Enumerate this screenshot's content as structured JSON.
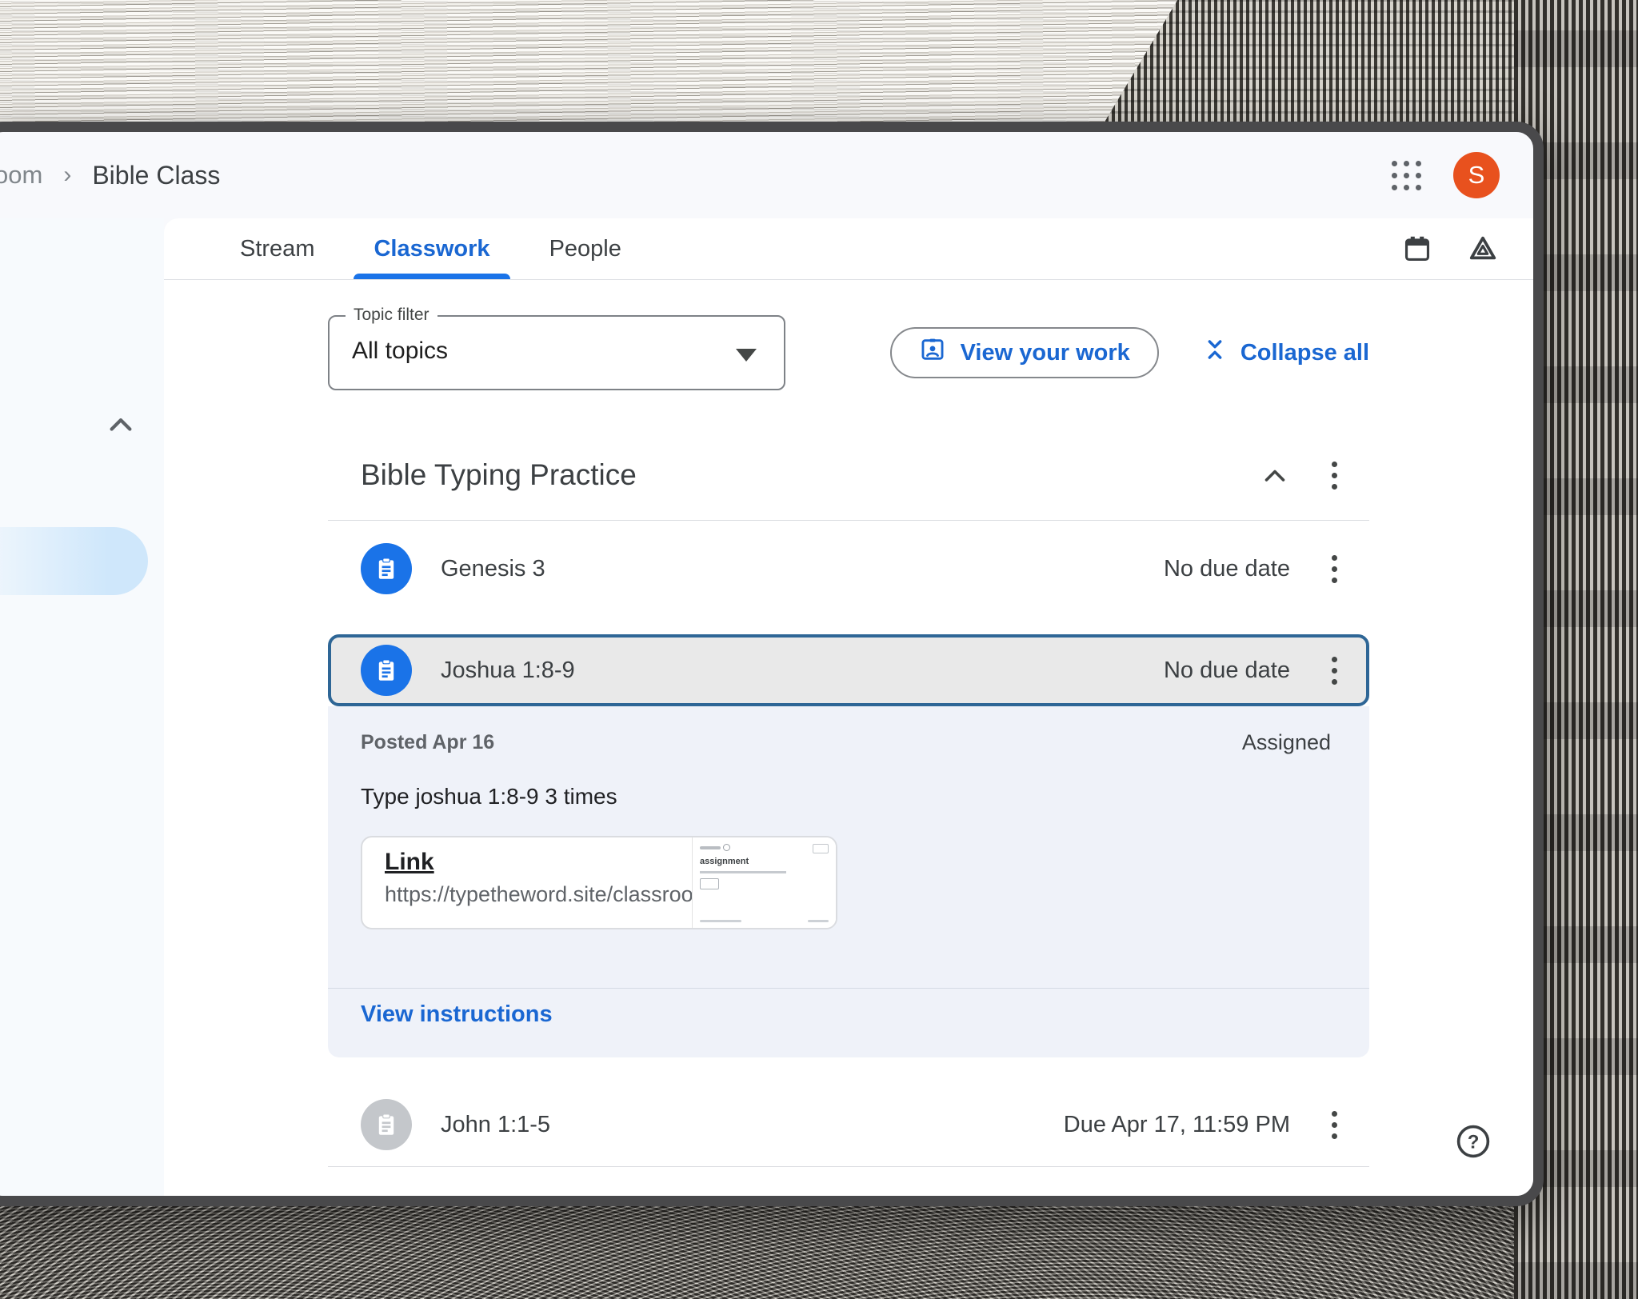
{
  "header": {
    "breadcrumb_prefix": "oom",
    "breadcrumb_separator": "›",
    "class_name": "Bible Class",
    "avatar_letter": "S"
  },
  "tabs": {
    "stream": "Stream",
    "classwork": "Classwork",
    "people": "People"
  },
  "toolbar": {
    "topic_filter_label": "Topic filter",
    "topic_filter_value": "All topics",
    "view_your_work_label": "View your work",
    "collapse_all_label": "Collapse all"
  },
  "section": {
    "title": "Bible Typing Practice"
  },
  "assignments": [
    {
      "title": "Genesis 3",
      "due": "No due date"
    },
    {
      "title": "Joshua 1:8-9",
      "due": "No due date"
    },
    {
      "title": "John 1:1-5",
      "due": "Due Apr 17, 11:59 PM"
    }
  ],
  "selected_details": {
    "posted": "Posted Apr 16",
    "status": "Assigned",
    "instructions": "Type joshua 1:8-9 3 times",
    "attachment_title": "Link",
    "attachment_url": "https://typetheword.site/classroo",
    "thumbnail_heading": "assignment",
    "footer_link": "View instructions"
  },
  "colors": {
    "accent_blue": "#1a67d2",
    "tab_underline_blue": "#1a73e8",
    "assignment_icon_blue": "#1a73e8",
    "assignment_icon_gray": "#c4c7cb",
    "selected_row_border": "#2e6696",
    "selected_row_background": "#e9e9e9",
    "details_background": "#eff2f9",
    "avatar_orange": "#e8511e"
  }
}
